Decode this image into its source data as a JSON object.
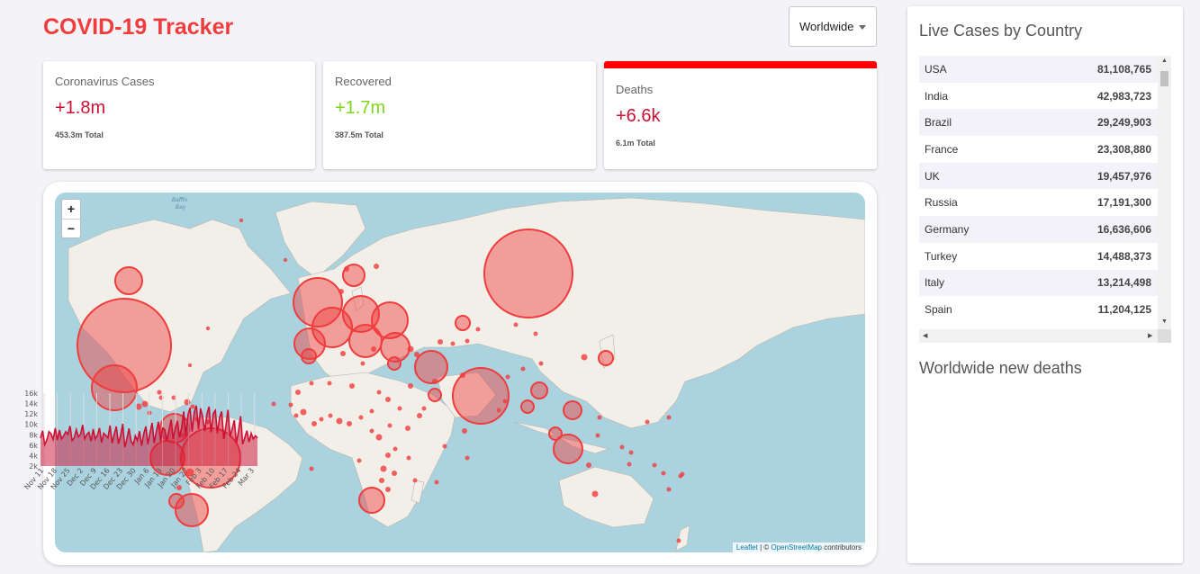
{
  "app": {
    "title": "COVID-19 Tracker"
  },
  "country_select": {
    "selected": "Worldwide"
  },
  "cards": [
    {
      "title": "Coronavirus Cases",
      "value": "+1.8m",
      "total": "453.3m Total",
      "value_color": "#cc1034",
      "active": false
    },
    {
      "title": "Recovered",
      "value": "+1.7m",
      "total": "387.5m Total",
      "value_color": "#7dd71d",
      "active": false
    },
    {
      "title": "Deaths",
      "value": "+6.6k",
      "total": "6.1m Total",
      "value_color": "#cc1034",
      "active": true
    }
  ],
  "map": {
    "zoom_in": "+",
    "zoom_out": "−",
    "attribution": {
      "leaflet": "Leaflet",
      "separator": " | © ",
      "osm": "OpenStreetMap",
      "suffix": " contributors"
    },
    "labels": {
      "baffin": "Baffin",
      "bay": "Bay"
    }
  },
  "sidebar": {
    "table_title": "Live Cases by Country",
    "countries": [
      {
        "name": "USA",
        "cases": "81,108,765"
      },
      {
        "name": "India",
        "cases": "42,983,723"
      },
      {
        "name": "Brazil",
        "cases": "29,249,903"
      },
      {
        "name": "France",
        "cases": "23,308,880"
      },
      {
        "name": "UK",
        "cases": "19,457,976"
      },
      {
        "name": "Russia",
        "cases": "17,191,300"
      },
      {
        "name": "Germany",
        "cases": "16,636,606"
      },
      {
        "name": "Turkey",
        "cases": "14,488,373"
      },
      {
        "name": "Italy",
        "cases": "13,214,498"
      },
      {
        "name": "Spain",
        "cases": "11,204,125"
      }
    ],
    "chart_title": "Worldwide new deaths"
  },
  "colors": {
    "accent": "#f03c3c",
    "circle_fill": "rgba(240,60,60,0.45)",
    "circle_stroke": "#f03c3c",
    "line": "#cc1034",
    "area": "rgba(204,16,52,0.5)"
  },
  "chart_data": {
    "type": "area",
    "title": "Worldwide new deaths",
    "x": [
      "Nov 11",
      "Nov 18",
      "Nov 25",
      "Dec 2",
      "Dec 9",
      "Dec 16",
      "Dec 23",
      "Dec 30",
      "Jan 6",
      "Jan 13",
      "Jan 20",
      "Jan 27",
      "Feb 3",
      "Feb 10",
      "Feb 17",
      "Feb 24",
      "Mar 3"
    ],
    "yticks": [
      "2k",
      "4k",
      "6k",
      "8k",
      "10k",
      "12k",
      "14k",
      "16k"
    ],
    "ylim": [
      2000,
      16000
    ],
    "grid": true,
    "series": [
      {
        "values": [
          7400,
          8800,
          6100,
          7000,
          8600,
          8200,
          7100,
          9300,
          7000,
          8900,
          7200,
          7800,
          8600,
          8100,
          9700,
          6900,
          7400,
          9000,
          7600,
          8100,
          9900,
          7200,
          8100,
          8500,
          6800,
          9100,
          7200,
          7900,
          9300,
          6500,
          8300,
          7900,
          7400,
          9800,
          6400,
          8100,
          9600,
          6300,
          7800,
          10100,
          5600,
          7200,
          9200,
          6800,
          6100,
          7800,
          6900,
          8700,
          5900,
          8200,
          9600,
          6200,
          8500,
          10300,
          6400,
          8700,
          10500,
          6800,
          9300,
          9000,
          6900,
          8800,
          10900,
          7200,
          9200,
          10700,
          7500,
          9400,
          12500,
          7800,
          11800,
          13200,
          8600,
          12400,
          13600,
          9100,
          13100,
          11400,
          8700,
          11900,
          13400,
          8500,
          12100,
          12700,
          8300,
          11300,
          12500,
          7200,
          9600,
          12800,
          7700,
          9100,
          10800,
          6400,
          8600,
          11600,
          6200,
          7500,
          8800,
          6600,
          8300,
          7200,
          7800,
          7400
        ]
      }
    ]
  }
}
